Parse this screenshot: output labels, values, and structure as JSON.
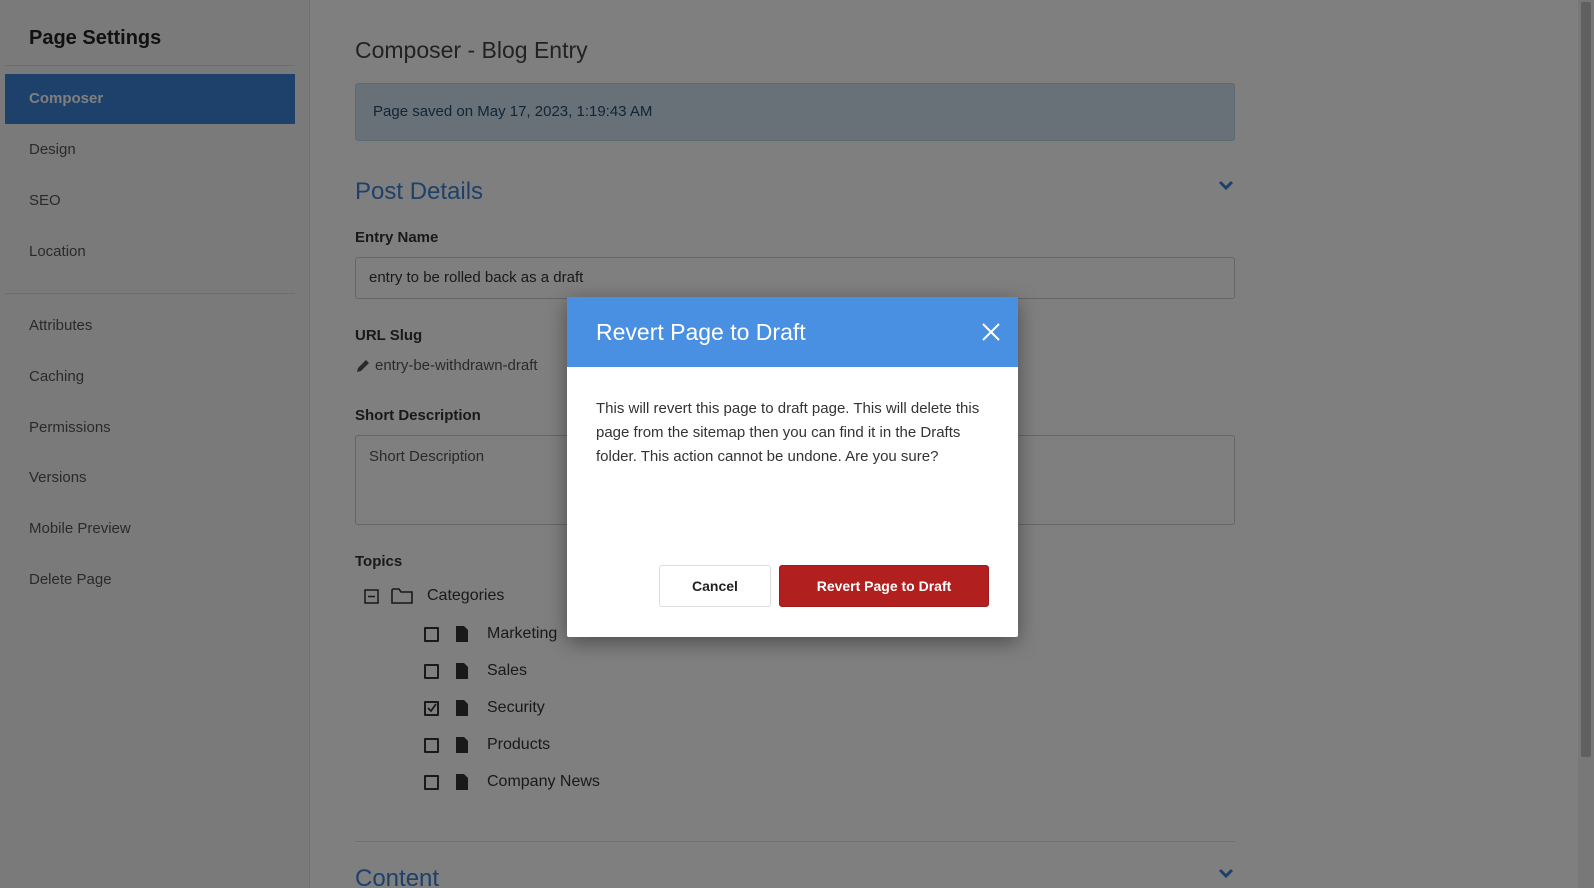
{
  "sidebar": {
    "title": "Page Settings",
    "items": [
      "Composer",
      "Design",
      "SEO",
      "Location",
      "Attributes",
      "Caching",
      "Permissions",
      "Versions",
      "Mobile Preview",
      "Delete Page"
    ]
  },
  "main": {
    "title": "Composer - Blog Entry",
    "alert": "Page saved on May 17, 2023, 1:19:43 AM",
    "post_details": {
      "heading": "Post Details",
      "entry_name_label": "Entry Name",
      "entry_name_value": "entry to be rolled back as a draft",
      "url_slug_label": "URL Slug",
      "url_slug_value": "entry-be-withdrawn-draft",
      "short_description_label": "Short Description",
      "short_description_placeholder": "Short Description",
      "topics_label": "Topics",
      "topics_root": "Categories",
      "topics": [
        {
          "label": "Marketing",
          "checked": false
        },
        {
          "label": "Sales",
          "checked": false
        },
        {
          "label": "Security",
          "checked": true
        },
        {
          "label": "Products",
          "checked": false
        },
        {
          "label": "Company News",
          "checked": false
        }
      ]
    },
    "content_heading": "Content"
  },
  "modal": {
    "title": "Revert Page to Draft",
    "body": "This will revert this page to draft page. This will delete this page from the sitemap then you can find it in the Drafts folder. This action cannot be undone. Are you sure?",
    "cancel_label": "Cancel",
    "confirm_label": "Revert Page to Draft"
  },
  "colors": {
    "accent": "#3b82d6",
    "modal_header": "#4a90e2",
    "danger": "#b21f1f"
  }
}
